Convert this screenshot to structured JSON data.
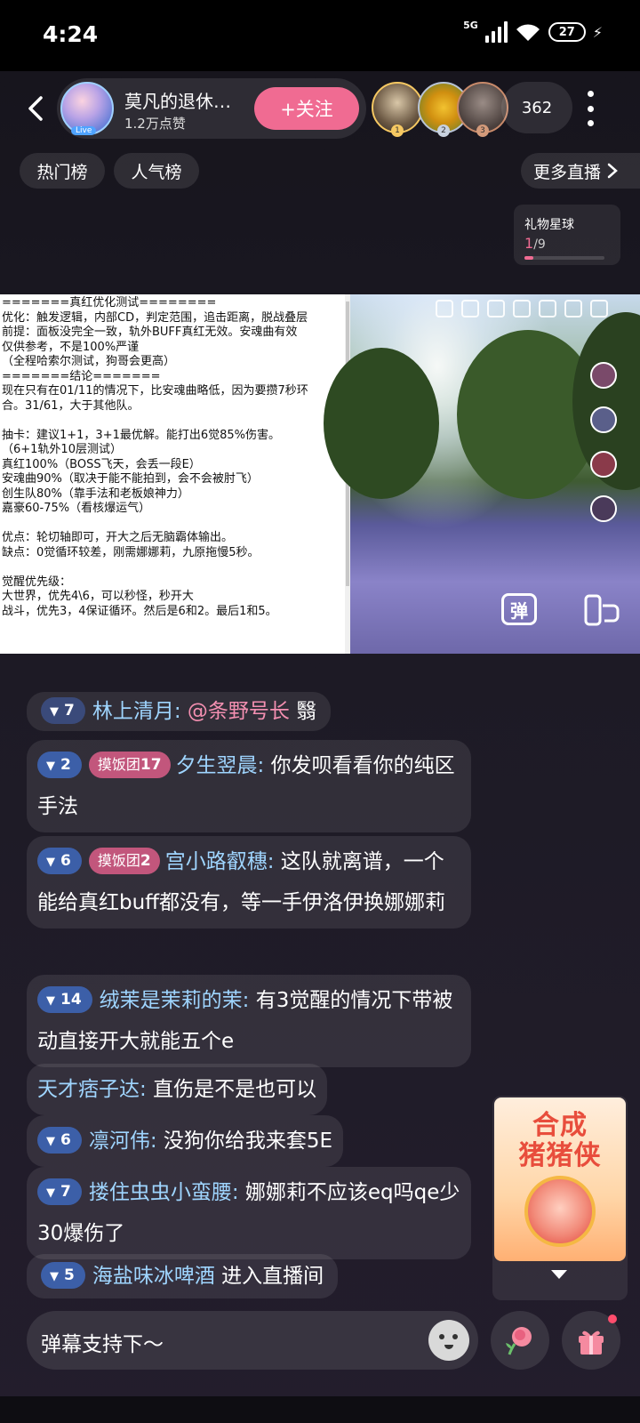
{
  "status_bar": {
    "time": "4:24",
    "network": "5G",
    "battery": "27"
  },
  "header": {
    "anchor_name": "莫凡的退休…",
    "likes": "1.2万点赞",
    "follow_label": "+关注",
    "viewer_count": "362",
    "top_ranks": [
      "1",
      "2",
      "3"
    ]
  },
  "rank_chips": {
    "hot": "热门榜",
    "popular": "人气榜",
    "more_live": "更多直播"
  },
  "gift_planet": {
    "title": "礼物星球",
    "current": "1",
    "total": "/9",
    "progress": 0.11
  },
  "video": {
    "notes": [
      "=======真红优化测试========",
      "优化：触发逻辑，内部CD，判定范围，追击距离，脱战叠层",
      "前提：面板没完全一致，轨外BUFF真红无效。安魂曲有效",
      "仅供参考，不是100%严谨",
      "（全程哈索尔测试，狗哥会更高）",
      "=======结论=======",
      "现在只有在01/11的情况下，比安魂曲略低，因为要攒7秒环",
      "合。31/61，大于其他队。",
      "",
      "抽卡：建议1+1，3+1最优解。能打出6觉85%伤害。",
      "（6+1轨外10层测试）",
      "真红100%（BOSS飞天，会丢一段E）",
      "安魂曲90%（取决于能不能拍到，会不会被肘飞）",
      "创生队80%（靠手法和老板娘神力）",
      "嘉豪60-75%（看核爆运气）",
      "",
      "优点：轮切轴即可，开大之后无脑霸体输出。",
      "缺点：0觉循环较差，刚需娜娜莉，九原拖慢5秒。",
      "",
      "觉醒优先级：",
      "大世界，优先4\\6，可以秒怪，秒开大",
      "战斗，优先3，4保证循环。然后是6和2。最后1和5。"
    ],
    "danmu_label": "弹"
  },
  "chat": [
    {
      "level": "7",
      "user": "林上清月:",
      "mention": "@条野号长",
      "text": "翳"
    },
    {
      "level": "2",
      "fan_name": "摸饭团",
      "fan_level": "17",
      "user": "夕生翌晨:",
      "text": "你发呗看看你的纯区手法"
    },
    {
      "level": "6",
      "fan_name": "摸饭团",
      "fan_level": "2",
      "user": "宫小路叡穗:",
      "text": "这队就离谱，一个能给真红buff都没有，等一手伊洛伊换娜娜莉"
    },
    {
      "level": "14",
      "user": "绒茉是茉莉的茉:",
      "text": "有3觉醒的情况下带被动直接开大就能五个e"
    },
    {
      "user": "天才痞子达:",
      "text": "直伤是不是也可以"
    },
    {
      "level": "6",
      "user": "凛河伟:",
      "text": "没狗你给我来套5E"
    },
    {
      "level": "7",
      "user": "搂住虫虫小蛮腰:",
      "text": "娜娜莉不应该eq吗qe少30爆伤了"
    },
    {
      "level": "5",
      "user": "海盐味冰啤酒",
      "text": "进入直播间"
    }
  ],
  "banner": {
    "line1": "合成",
    "line2": "猪猪侠"
  },
  "input": {
    "placeholder": "弹幕支持下～"
  },
  "colors": {
    "accent": "#f06b92",
    "username": "#9fd5ff",
    "mention": "#f48fb1",
    "level_badge": "#3c5fa8",
    "fan_badge": "#c2567c"
  }
}
